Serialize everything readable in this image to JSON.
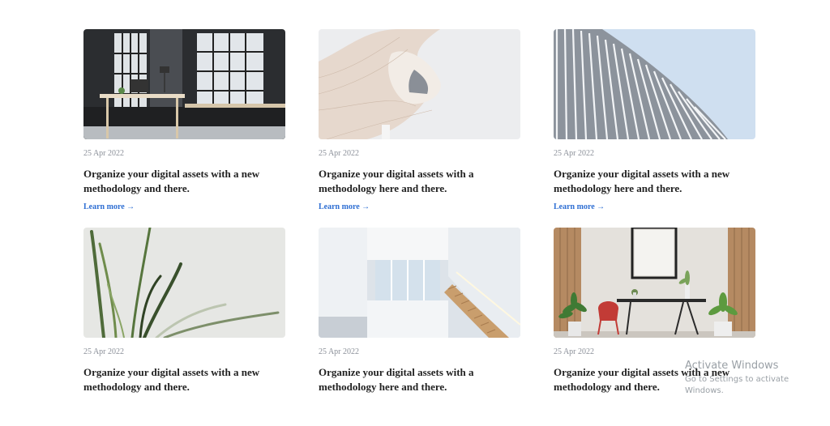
{
  "cards": [
    {
      "date": "25 Apr 2022",
      "title": "Organize your digital assets with a new methodology and there.",
      "link": "Learn more →",
      "image": "office-desk-image"
    },
    {
      "date": "25 Apr 2022",
      "title": "Organize your digital assets with a methodology here and there.",
      "link": "Learn more →",
      "image": "curved-building-image"
    },
    {
      "date": "25 Apr 2022",
      "title": "Organize your digital assets with a new methodology here and there.",
      "link": "Learn more →",
      "image": "ribbed-facade-image"
    },
    {
      "date": "25 Apr 2022",
      "title": "Organize your digital assets with a new methodology and there.",
      "link": "",
      "image": "plant-leaves-image"
    },
    {
      "date": "25 Apr 2022",
      "title": "Organize your digital assets with a methodology here and there.",
      "link": "",
      "image": "white-staircase-image"
    },
    {
      "date": "25 Apr 2022",
      "title": "Organize your digital assets with a new methodology and there.",
      "link": "",
      "image": "living-room-image"
    }
  ],
  "watermark": {
    "title": "Activate Windows",
    "subtitle": "Go to Settings to activate Windows."
  },
  "colors": {
    "link": "#2f6fd3",
    "date": "#8a8f98",
    "title": "#222222"
  }
}
